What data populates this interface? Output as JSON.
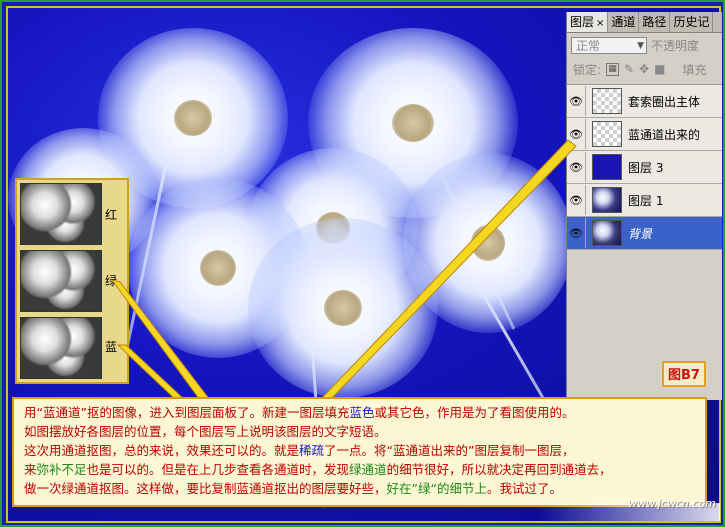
{
  "panel": {
    "tabs": [
      {
        "label": "图层",
        "close": "×"
      },
      {
        "label": "通道"
      },
      {
        "label": "路径"
      },
      {
        "label": "历史记"
      }
    ],
    "blend_mode": "正常",
    "opacity_label": "不透明度",
    "lock_label": "锁定:",
    "fill_label": "填充",
    "layers": [
      {
        "name": "套索圈出主体"
      },
      {
        "name": "蓝通道出来的"
      },
      {
        "name": "图层 3"
      },
      {
        "name": "图层 1"
      },
      {
        "name": "背景"
      }
    ]
  },
  "channels": [
    {
      "label": "红"
    },
    {
      "label": "绿"
    },
    {
      "label": "蓝"
    }
  ],
  "figure_tag": "图B7",
  "caption": {
    "p1a": "    用“蓝通道”抠的图像，进入到图层面板了。新建一图层填充",
    "p1b": "蓝色",
    "p1c": "或其它色，作用是为了看图使用的。",
    "p2": "如图摆放好各图层的位置，每个图层写上说明该图层的文字短语。",
    "p3a": "    这次用通道抠图，总的来说，效果还可以的。就是",
    "p3b": "稀疏",
    "p3c": "了一点。将“蓝通道出来的”图层复制一图层，",
    "p4a": "来",
    "p4b": "弥补不足",
    "p4c": "也是可以的。但是在上几步查看各通道时，发现",
    "p4d": "绿通道",
    "p4e": "的细节很好，所以就决定再回到通道去，",
    "p5a": "做一次绿通道抠图。这样做，要比复制蓝通道抠出的图层要好些，",
    "p5b": "好在”绿“的细节上",
    "p5c": "。我试过了。"
  },
  "watermark": "www.jcwcn.com"
}
